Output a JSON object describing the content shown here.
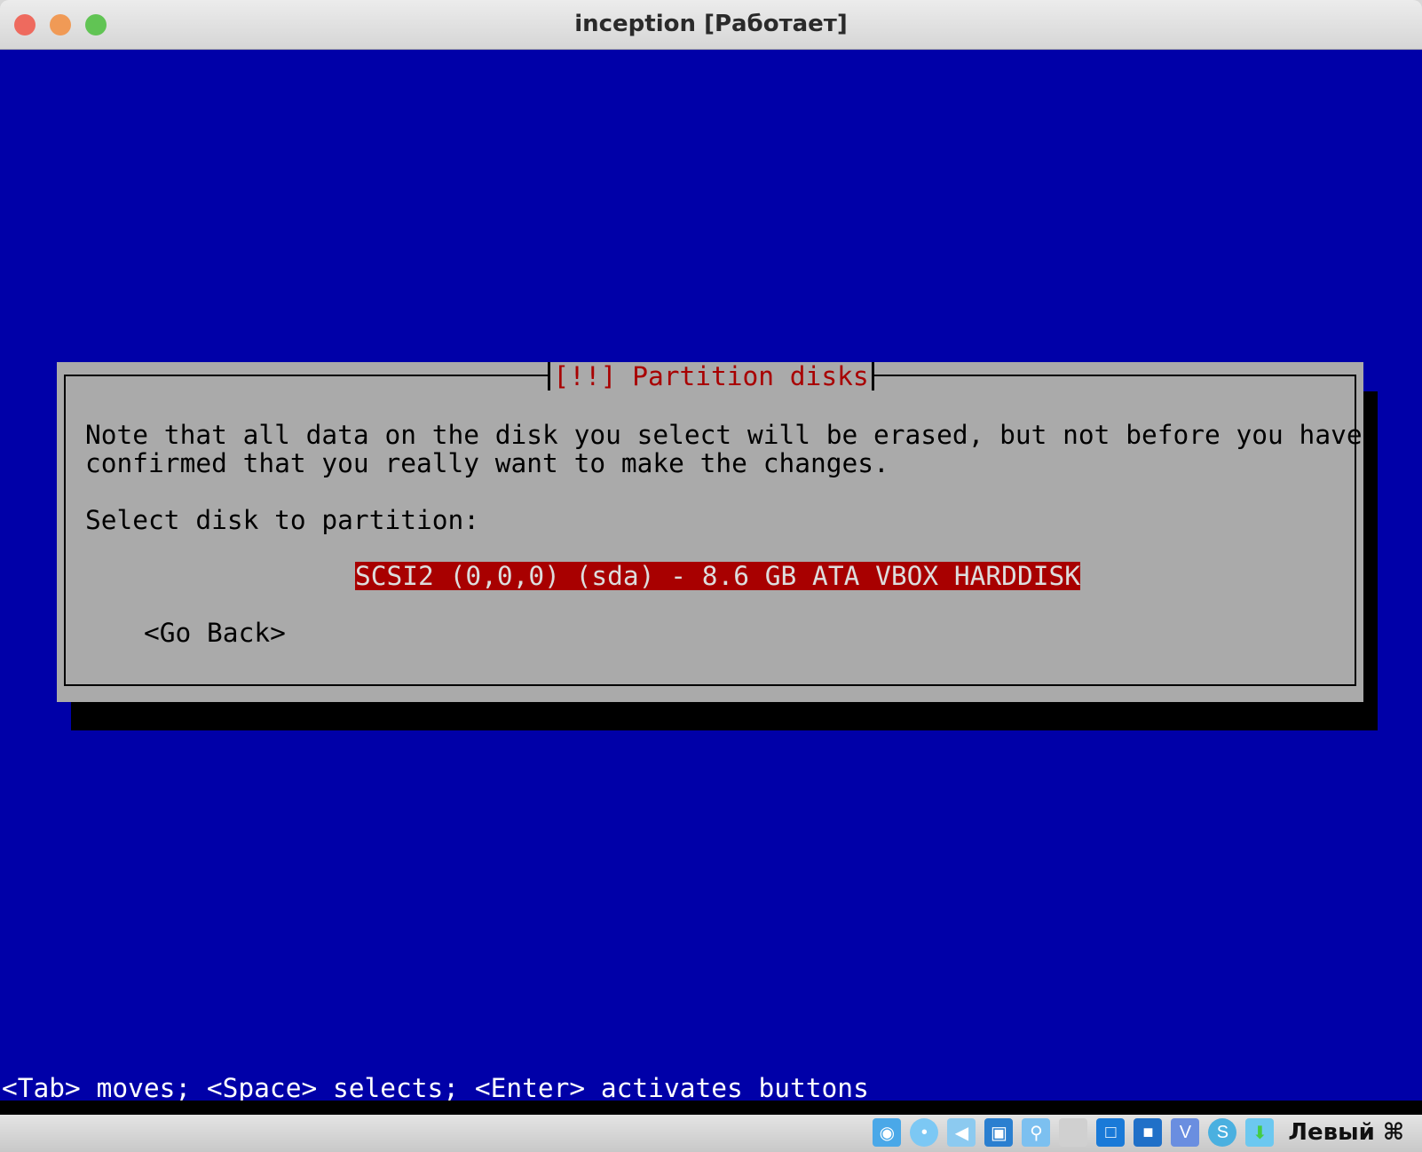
{
  "window": {
    "title": "inception [Работает]",
    "controls": {
      "close_color": "#ee6a5e",
      "minimize_color": "#f09a56",
      "zoom_color": "#61c454"
    }
  },
  "installer": {
    "background_color": "#0000a8",
    "dialog": {
      "title": "[!!] Partition disks",
      "message_line1": "Note that all data on the disk you select will be erased, but not before you have",
      "message_line2": "confirmed that you really want to make the changes.",
      "prompt": "Select disk to partition:",
      "options": [
        {
          "label": "SCSI2 (0,0,0) (sda) - 8.6 GB ATA VBOX HARDDISK",
          "selected": true
        }
      ],
      "go_back": "<Go Back>"
    },
    "hint": "<Tab> moves; <Space> selects; <Enter> activates buttons"
  },
  "statusbar": {
    "icons": [
      "hard-disk-icon",
      "optical-drive-icon",
      "audio-icon",
      "network-icon",
      "usb-icon",
      "shared-folder-icon",
      "display-icon",
      "video-capture-icon",
      "cpu-activity-icon",
      "guest-additions-icon",
      "download-icon"
    ],
    "host_key": "Левый ⌘"
  }
}
